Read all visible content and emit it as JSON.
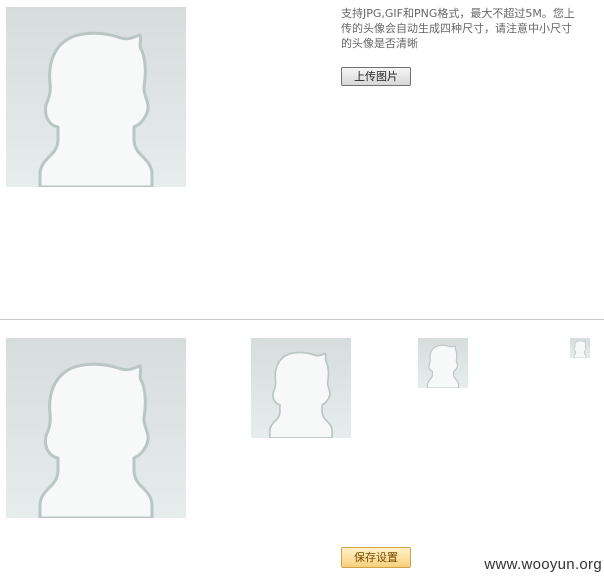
{
  "upload": {
    "instructions": "支持JPG,GIF和PNG格式，最大不超过5M。您上传的头像会自动生成四种尺寸，请注意中小尺寸的头像是否清晰",
    "button_label": "上传图片"
  },
  "icons": {
    "placeholder": "default-avatar-silhouette-icon"
  },
  "previews": {
    "save_label": "保存设置"
  },
  "watermark": "www.wooyun.org",
  "colors": {
    "avatar_bg_top": "#d6dddc",
    "avatar_bg_bottom": "#e7ecec",
    "save_button": "#fde0a0"
  }
}
